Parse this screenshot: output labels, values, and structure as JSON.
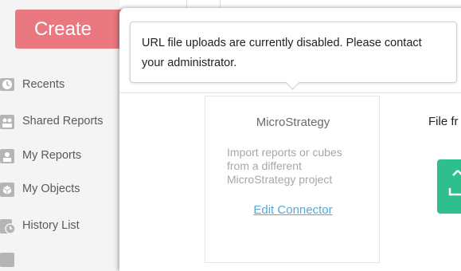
{
  "sidebar": {
    "create_label": "Create",
    "items": [
      {
        "label": "Recents",
        "icon": "clock-icon"
      },
      {
        "label": "Shared Reports",
        "icon": "users-icon"
      },
      {
        "label": "My Reports",
        "icon": "user-icon"
      },
      {
        "label": "My Objects",
        "icon": "cube-icon"
      },
      {
        "label": "History List",
        "icon": "history-icon"
      }
    ]
  },
  "tooltip": {
    "message": "URL file uploads are currently disabled. Please contact your administrator."
  },
  "connector": {
    "title": "MicroStrategy",
    "description": "Import reports or cubes from a different MicroStrategy project",
    "link_label": "Edit Connector"
  },
  "connector2": {
    "title": "File fr",
    "icon": "upload-icon",
    "color": "#2fbf8c"
  },
  "colors": {
    "create_button": "#e97880",
    "link": "#5aa7d4"
  }
}
